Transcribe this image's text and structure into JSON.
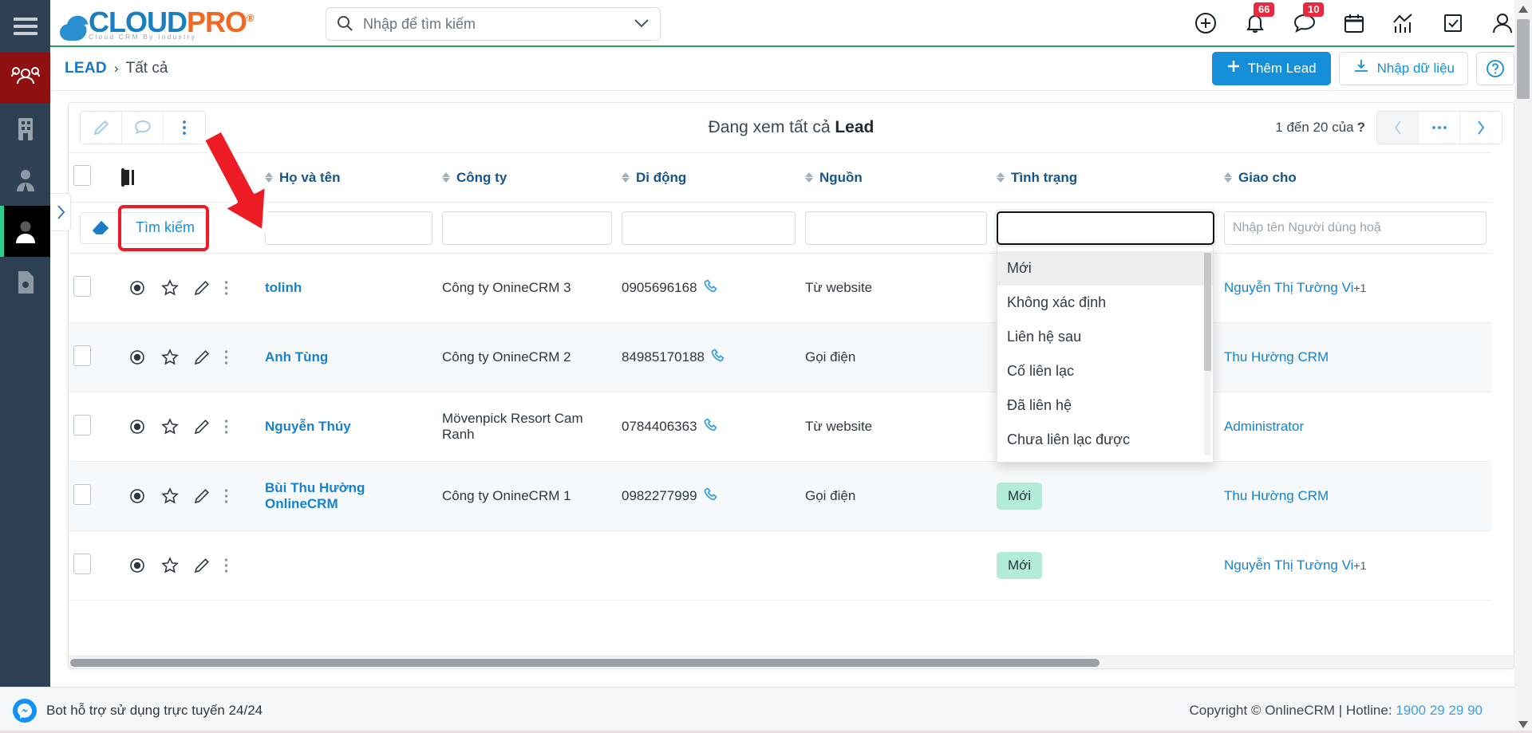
{
  "topbar": {
    "logo": {
      "part1": "CLOUD",
      "part2": "PRO",
      "tagline": "Cloud CRM By Industry",
      "reg": "®"
    },
    "search_placeholder": "Nhập để tìm kiếm",
    "notifications_badge": "66",
    "messages_badge": "10"
  },
  "crumb": {
    "module": "LEAD",
    "separator": "›",
    "current": "Tất cả",
    "add_lead": "Thêm Lead",
    "import": "Nhập dữ liệu"
  },
  "toolbar": {
    "view_title_prefix": "Đang xem tất cả ",
    "view_title_bold": "Lead",
    "pager_text": "1 đến 20 của",
    "pager_unknown": "?",
    "prev": "‹",
    "more": "•••",
    "next": "›"
  },
  "table": {
    "columns": [
      {
        "key": "name",
        "label": "Họ và tên"
      },
      {
        "key": "company",
        "label": "Công ty"
      },
      {
        "key": "mobile",
        "label": "Di động"
      },
      {
        "key": "source",
        "label": "Nguồn"
      },
      {
        "key": "status",
        "label": "Tình trạng"
      },
      {
        "key": "assigned",
        "label": "Giao cho"
      }
    ],
    "filter": {
      "search_label": "Tìm kiếm",
      "name_value": "",
      "company_value": "",
      "mobile_value": "",
      "source_value": "",
      "status_value": "",
      "assigned_placeholder": "Nhập tên Người dùng hoặ"
    },
    "status_dropdown": {
      "options": [
        "Mới",
        "Không xác định",
        "Liên hệ sau",
        "Cố liên lạc",
        "Đã liên hệ",
        "Chưa liên lạc được"
      ],
      "highlighted_index": 0
    },
    "rows": [
      {
        "name": "tolinh",
        "company": "Công ty OnineCRM 3",
        "mobile": "0905696168",
        "source": "Từ website",
        "status": "",
        "assigned": "Nguyễn Thị Tường Vi",
        "assigned_extra": "+1"
      },
      {
        "name": "Anh Tùng",
        "company": "Công ty OnineCRM 2",
        "mobile": "84985170188",
        "source": "Gọi điện",
        "status": "",
        "assigned": "Thu Hường CRM",
        "assigned_extra": ""
      },
      {
        "name": "Nguyễn Thúy",
        "company": "Mövenpick Resort Cam Ranh",
        "mobile": "0784406363",
        "source": "Từ website",
        "status": "",
        "assigned": "Administrator",
        "assigned_extra": ""
      },
      {
        "name": "Bùi Thu Hường OnlineCRM",
        "company": "Công ty OnineCRM 1",
        "mobile": "0982277999",
        "source": "Gọi điện",
        "status": "Mới",
        "assigned": "Thu Hường CRM",
        "assigned_extra": ""
      },
      {
        "name": "",
        "company": "",
        "mobile": "",
        "source": "",
        "status": "Mới",
        "assigned": "Nguyễn Thị Tường Vi",
        "assigned_extra": "+1"
      }
    ]
  },
  "footer": {
    "bot_text": "Bot hỗ trợ sử dụng trực tuyến 24/24",
    "copyright": "Copyright © OnlineCRM | Hotline: ",
    "hotline": "1900 29 29 90"
  },
  "colors": {
    "accent_blue": "#1590d8",
    "link_blue": "#1682cf",
    "rail_bg": "#2e4154",
    "active_red": "#8e1010",
    "badge_red": "#e8293f",
    "badge_new_bg": "#b2ecd9",
    "arrow_red": "#ed1c24",
    "green_line": "#2a9d63"
  }
}
